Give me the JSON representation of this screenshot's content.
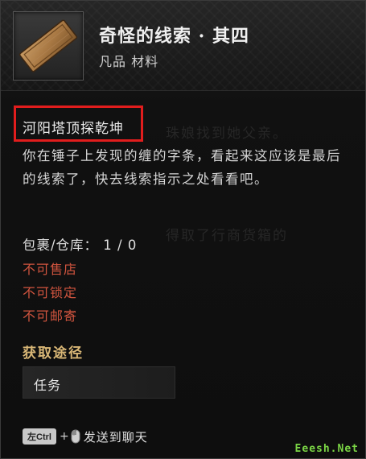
{
  "item": {
    "title": "奇怪的线索 · 其四",
    "subtitle": "凡品  材料",
    "icon": "paper-scroll-icon"
  },
  "hint": {
    "title": "河阳塔顶探乾坤"
  },
  "description": "你在锤子上发现的缠的字条，看起来这应该是最后的线索了，快去线索指示之处看看吧。",
  "background_ghost": {
    "line1": "珠娘找到她父亲。",
    "line2": "得取了行商货箱的"
  },
  "storage": {
    "text": "包裹/仓库： 1 / 0"
  },
  "restrictions": [
    "不可售店",
    "不可锁定",
    "不可邮寄"
  ],
  "acquire": {
    "heading": "获取途径",
    "source": "任务"
  },
  "footer": {
    "key": "左Ctrl",
    "plus": "+",
    "action": "发送到聊天"
  },
  "watermark": "Eeesh.Net",
  "colors": {
    "highlight": "#e11d1d",
    "restriction": "#d2553f",
    "section_heading": "#d9b776"
  }
}
